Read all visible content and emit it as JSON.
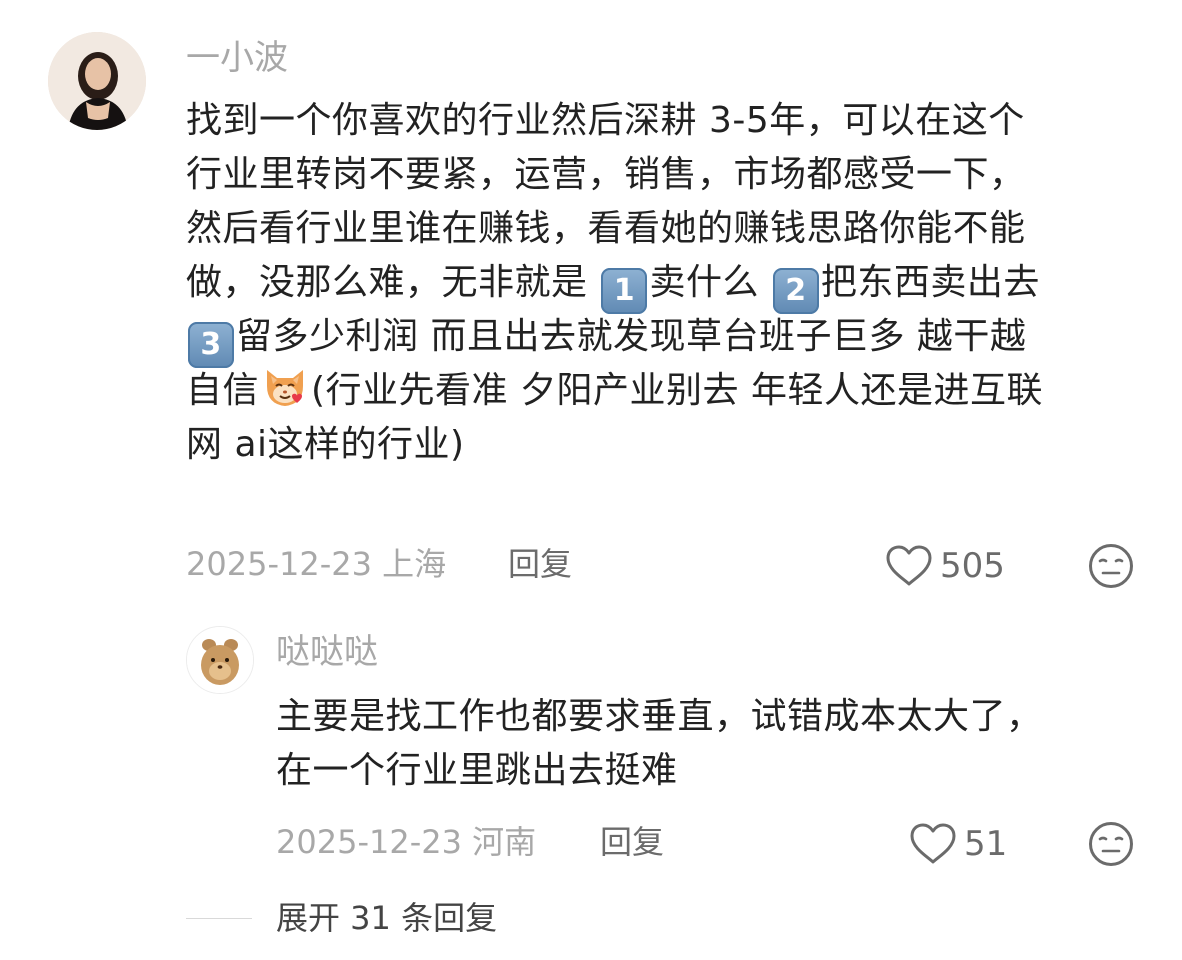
{
  "comment": {
    "username": "一小波",
    "lines": [
      [
        "找到一个你喜欢的行业然后深耕 3-5年，可以在这个"
      ],
      [
        "行业里转岗不要紧，运营，销售，市场都感受一下，"
      ],
      [
        "然后看行业里谁在赚钱，看看她的赚钱思路你能不能"
      ],
      [
        "做，没那么难，无非就是 ",
        "1",
        "卖什么 ",
        "2",
        "把东西卖出去"
      ],
      [
        "3",
        "留多少利润 而且出去就发现草台班子巨多 越干越"
      ],
      [
        "自信",
        "(行业先看准 夕阳产业别去 年轻人还是进互联"
      ],
      [
        "网 ai这样的行业)"
      ]
    ],
    "keycaps": [
      "1",
      "2",
      "3"
    ],
    "segments": {
      "l1": "找到一个你喜欢的行业然后深耕 3-5年，可以在这个",
      "l2": "行业里转岗不要紧，运营，销售，市场都感受一下，",
      "l3": "然后看行业里谁在赚钱，看看她的赚钱思路你能不能",
      "l4a": "做，没那么难，无非就是 ",
      "l4b": "卖什么 ",
      "l4c": "把东西卖出去",
      "l5": "留多少利润 而且出去就发现草台班子巨多 越干越",
      "l6a": "自信",
      "l6b": "(行业先看准 夕阳产业别去 年轻人还是进互联",
      "l7": "网 ai这样的行业)"
    },
    "emoji": "cat-face-with-heart-emoji",
    "date": "2025-12-23",
    "location": "上海",
    "reply_label": "回复",
    "like_count": "505"
  },
  "reply": {
    "username": "哒哒哒",
    "l1": "主要是找工作也都要求垂直，试错成本太大了，",
    "l2": "在一个行业里跳出去挺难",
    "date": "2025-12-23",
    "location": "河南",
    "reply_label": "回复",
    "like_count": "51"
  },
  "expand": {
    "label": "展开 31 条回复"
  },
  "colors": {
    "meta_gray": "#a8a8a8",
    "text": "#222222",
    "keycap_blue": "#6f97c0"
  },
  "icons": [
    "heart-outline-icon",
    "neutral-face-icon",
    "cat-heart-emoji",
    "keycap-digit-emoji"
  ]
}
